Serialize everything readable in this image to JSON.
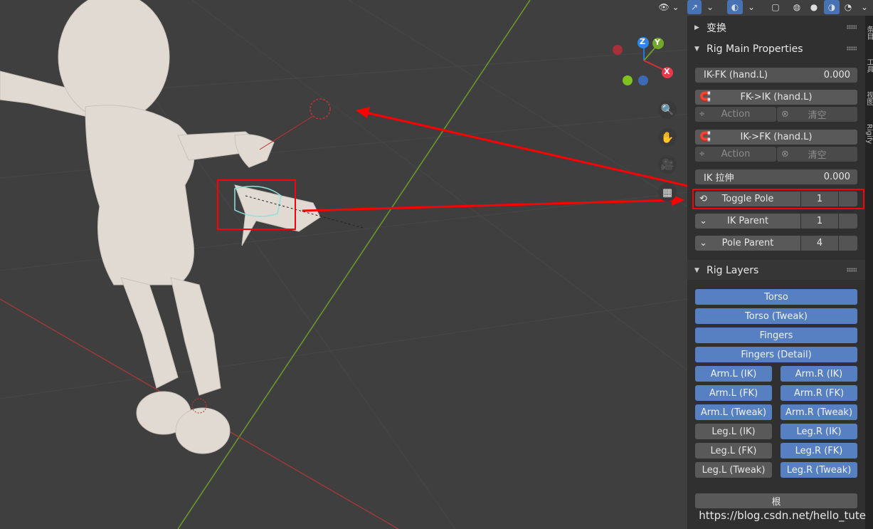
{
  "sidebar_tabs": [
    "条目",
    "工具",
    "视图",
    "Rigify"
  ],
  "panel": {
    "transform_title": "变换",
    "main_title": "Rig Main Properties",
    "ikfk": {
      "label": "IK-FK (hand.L)",
      "value": "0.000"
    },
    "fk_to_ik": {
      "label": "FK->IK (hand.L)",
      "action": "Action",
      "clear": "清空"
    },
    "ik_to_fk": {
      "label": "IK->FK (hand.L)",
      "action": "Action",
      "clear": "清空"
    },
    "ik_stretch": {
      "label": "IK 拉伸",
      "value": "0.000"
    },
    "toggle_pole": {
      "label": "Toggle Pole",
      "value": "1"
    },
    "ik_parent": {
      "label": "IK Parent",
      "value": "1"
    },
    "pole_parent": {
      "label": "Pole Parent",
      "value": "4"
    },
    "layers_title": "Rig Layers",
    "layers_full": [
      {
        "label": "Torso",
        "active": true
      },
      {
        "label": "Torso (Tweak)",
        "active": true
      },
      {
        "label": "Fingers",
        "active": true
      },
      {
        "label": "Fingers (Detail)",
        "active": true
      }
    ],
    "layers_pairs": [
      [
        {
          "label": "Arm.L (IK)",
          "active": true
        },
        {
          "label": "Arm.R (IK)",
          "active": true
        }
      ],
      [
        {
          "label": "Arm.L (FK)",
          "active": true
        },
        {
          "label": "Arm.R (FK)",
          "active": true
        }
      ],
      [
        {
          "label": "Arm.L (Tweak)",
          "active": true
        },
        {
          "label": "Arm.R (Tweak)",
          "active": true
        }
      ],
      [
        {
          "label": "Leg.L (IK)",
          "active": false
        },
        {
          "label": "Leg.R (IK)",
          "active": true
        }
      ],
      [
        {
          "label": "Leg.L (FK)",
          "active": false
        },
        {
          "label": "Leg.R (FK)",
          "active": true
        }
      ],
      [
        {
          "label": "Leg.L (Tweak)",
          "active": false
        },
        {
          "label": "Leg.R (Tweak)",
          "active": true
        }
      ]
    ],
    "root_label": "根"
  },
  "gizmo": {
    "z": "Z",
    "y": "Y",
    "x": "X"
  },
  "watermark": "https://blog.csdn.net/hello_tute",
  "colors": {
    "layer_active": "#5680c2",
    "layer_inactive": "#595959",
    "annotation": "#ff0000"
  }
}
